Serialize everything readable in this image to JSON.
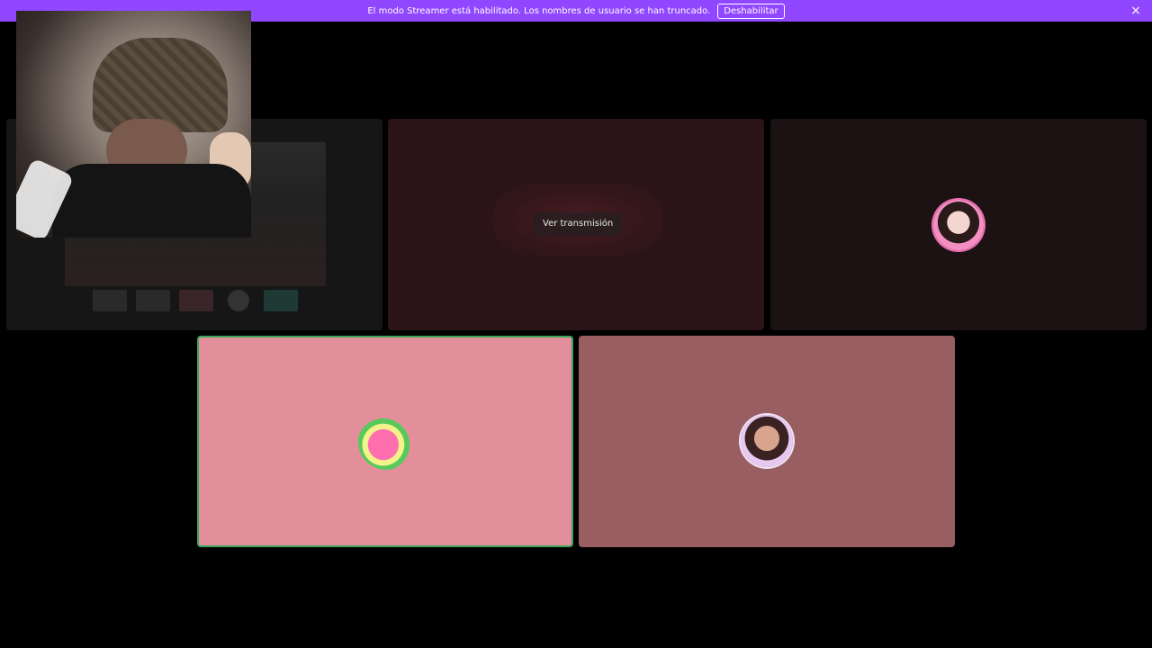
{
  "banner": {
    "message": "El modo Streamer está habilitado. Los nombres de usuario se han truncado.",
    "disable_label": "Deshabilitar",
    "close_icon": "×",
    "color": "#9146ff"
  },
  "stream_tile": {
    "watch_label": "Ver transmisión"
  },
  "colors": {
    "speaking_border": "#3ba55c",
    "tile_pink": "#e38f9b",
    "tile_mauve": "#985e62"
  },
  "icons": {
    "close": "close-icon"
  }
}
